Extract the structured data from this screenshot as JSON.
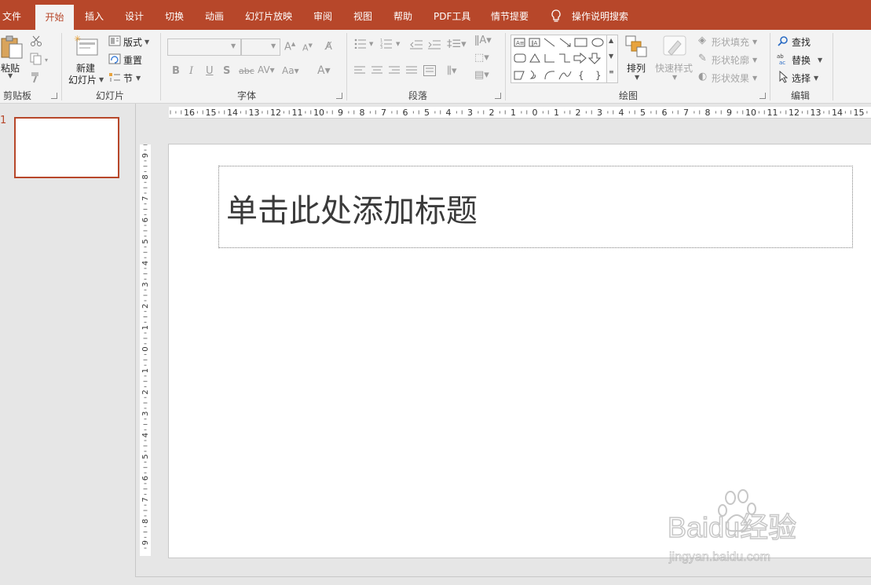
{
  "tabs": [
    {
      "label": "文件",
      "active": false
    },
    {
      "label": "开始",
      "active": true
    },
    {
      "label": "插入",
      "active": false
    },
    {
      "label": "设计",
      "active": false
    },
    {
      "label": "切换",
      "active": false
    },
    {
      "label": "动画",
      "active": false
    },
    {
      "label": "幻灯片放映",
      "active": false
    },
    {
      "label": "审阅",
      "active": false
    },
    {
      "label": "视图",
      "active": false
    },
    {
      "label": "帮助",
      "active": false
    },
    {
      "label": "PDF工具",
      "active": false
    },
    {
      "label": "情节提要",
      "active": false
    }
  ],
  "tell_me": "操作说明搜索",
  "ribbon": {
    "clipboard": {
      "label": "剪贴板",
      "paste": "粘贴"
    },
    "slides": {
      "label": "幻灯片",
      "new_slide_line1": "新建",
      "new_slide_line2": "幻灯片",
      "layout": "版式",
      "reset": "重置",
      "section": "节"
    },
    "font": {
      "label": "字体"
    },
    "paragraph": {
      "label": "段落"
    },
    "drawing": {
      "label": "绘图",
      "arrange": "排列",
      "quick_styles": "快速样式",
      "shape_fill": "形状填充",
      "shape_outline": "形状轮廓",
      "shape_effects": "形状效果"
    },
    "editing": {
      "label": "编辑",
      "find": "查找",
      "replace": "替换",
      "select": "选择"
    }
  },
  "slide_panel": {
    "slide_number": "1"
  },
  "ruler": {
    "horizontal": [
      "16",
      "15",
      "14",
      "13",
      "12",
      "11",
      "10",
      "9",
      "8",
      "7",
      "6",
      "5",
      "4",
      "3",
      "2",
      "1",
      "0",
      "1",
      "2",
      "3",
      "4",
      "5",
      "6",
      "7",
      "8",
      "9",
      "10",
      "11",
      "12",
      "13",
      "14",
      "15"
    ],
    "vertical": [
      "9",
      "8",
      "7",
      "6",
      "5",
      "4",
      "3",
      "2",
      "1",
      "0",
      "1",
      "2",
      "3",
      "4",
      "5",
      "6",
      "7",
      "8",
      "9"
    ]
  },
  "slide": {
    "title_placeholder": "单击此处添加标题"
  },
  "watermark": {
    "brand": "Baidu经验",
    "url": "jingyan.baidu.com"
  },
  "colors": {
    "accent": "#b7472a",
    "ribbon_bg": "#f3f3f3",
    "workspace": "#e6e6e6"
  }
}
